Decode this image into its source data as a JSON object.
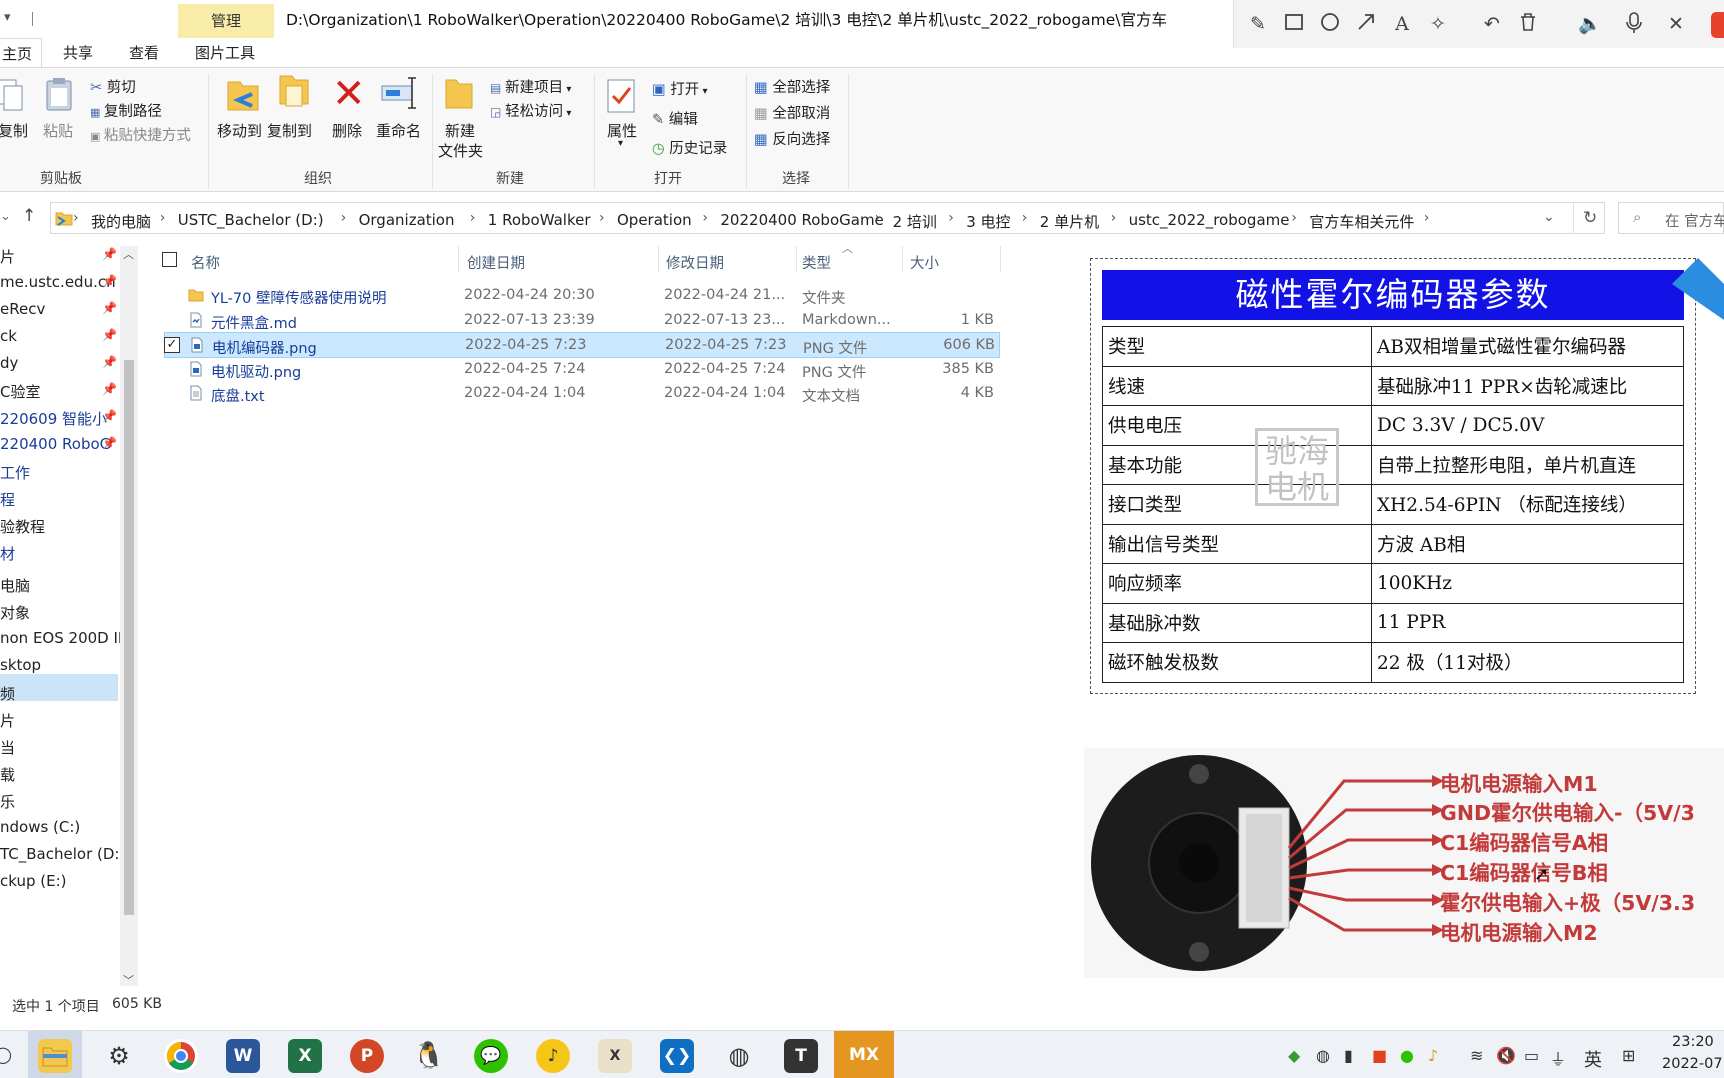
{
  "window": {
    "path_title": "D:\\Organization\\1 RoboWalker\\Operation\\20220400 RoboGame\\2 培训\\3 电控\\2 单片机\\ustc_2022_robogame\\官方车",
    "context_tab": "管理"
  },
  "ribbon_tabs": [
    "主页",
    "共享",
    "查看",
    "图片工具"
  ],
  "ribbon": {
    "copy_label": "复制",
    "paste_label": "粘贴",
    "cut_label": "剪切",
    "copy_path_label": "复制路径",
    "paste_shortcut_label": "粘贴快捷方式",
    "clipboard_group": "剪贴板",
    "move_to_label": "移动到",
    "copy_to_label": "复制到",
    "delete_label": "删除",
    "rename_label": "重命名",
    "organize_group": "组织",
    "new_item_label": "新建项目",
    "easy_access_label": "轻松访问",
    "new_folder_label_1": "新建",
    "new_folder_label_2": "文件夹",
    "new_group": "新建",
    "properties_label": "属性",
    "open_label": "打开",
    "edit_label": "编辑",
    "history_label": "历史记录",
    "open_group": "打开",
    "select_all_label": "全部选择",
    "select_none_label": "全部取消",
    "invert_selection_label": "反向选择",
    "select_group": "选择"
  },
  "breadcrumb": [
    "我的电脑",
    "USTC_Bachelor (D:)",
    "Organization",
    "1 RoboWalker",
    "Operation",
    "20220400 RoboGame",
    "2 培训",
    "3 电控",
    "2 单片机",
    "ustc_2022_robogame",
    "官方车相关元件"
  ],
  "search": {
    "placeholder": "在 官方车"
  },
  "nav_items": [
    {
      "label": "片",
      "pinned": true,
      "blue": false
    },
    {
      "label": "me.ustc.edu.cn",
      "pinned": true,
      "blue": false
    },
    {
      "label": "eRecv",
      "pinned": true,
      "blue": false
    },
    {
      "label": "ck",
      "pinned": true,
      "blue": false
    },
    {
      "label": "dy",
      "pinned": true,
      "blue": false
    },
    {
      "label": "C验室",
      "pinned": true,
      "blue": false
    },
    {
      "label": "220609 智能小",
      "pinned": true,
      "blue": true
    },
    {
      "label": "220400 RoboG",
      "pinned": true,
      "blue": true
    },
    {
      "label": "工作",
      "pinned": false,
      "blue": true
    },
    {
      "label": "程",
      "pinned": false,
      "blue": true
    },
    {
      "label": "验教程",
      "pinned": false,
      "blue": false
    },
    {
      "label": "材",
      "pinned": false,
      "blue": true
    },
    {
      "label": "电脑",
      "pinned": false,
      "blue": false
    },
    {
      "label": "对象",
      "pinned": false,
      "blue": false
    },
    {
      "label": "non EOS 200D II",
      "pinned": false,
      "blue": false
    },
    {
      "label": "sktop",
      "pinned": false,
      "blue": false
    },
    {
      "label": "频",
      "pinned": false,
      "blue": false
    },
    {
      "label": "片",
      "pinned": false,
      "blue": false
    },
    {
      "label": "当",
      "pinned": false,
      "blue": false
    },
    {
      "label": "载",
      "pinned": false,
      "blue": false
    },
    {
      "label": "乐",
      "pinned": false,
      "blue": false
    },
    {
      "label": "ndows (C:)",
      "pinned": false,
      "blue": false
    },
    {
      "label": "TC_Bachelor (D:)",
      "pinned": false,
      "blue": false
    },
    {
      "label": "ckup (E:)",
      "pinned": false,
      "blue": false
    }
  ],
  "columns": {
    "name": "名称",
    "created": "创建日期",
    "modified": "修改日期",
    "type": "类型",
    "size": "大小"
  },
  "files": [
    {
      "name": "YL-70 壁障传感器使用说明",
      "created": "2022-04-24 20:30",
      "modified": "2022-04-24 21...",
      "type": "文件夹",
      "size": "",
      "icon": "folder-icon",
      "selected": false
    },
    {
      "name": "元件黑盒.md",
      "created": "2022-07-13 23:39",
      "modified": "2022-07-13 23...",
      "type": "Markdown...",
      "size": "1 KB",
      "icon": "markdown-file-icon",
      "selected": false
    },
    {
      "name": "电机编码器.png",
      "created": "2022-04-25 7:23",
      "modified": "2022-04-25 7:23",
      "type": "PNG 文件",
      "size": "606 KB",
      "icon": "image-file-icon",
      "selected": true
    },
    {
      "name": "电机驱动.png",
      "created": "2022-04-25 7:24",
      "modified": "2022-04-25 7:24",
      "type": "PNG 文件",
      "size": "385 KB",
      "icon": "image-file-icon",
      "selected": false
    },
    {
      "name": "底盘.txt",
      "created": "2022-04-24 1:04",
      "modified": "2022-04-24 1:04",
      "type": "文本文档",
      "size": "4 KB",
      "icon": "text-file-icon",
      "selected": false
    }
  ],
  "preview": {
    "title": "磁性霍尔编码器参数",
    "rows": [
      {
        "k": "类型",
        "v": "AB双相增量式磁性霍尔编码器"
      },
      {
        "k": "线速",
        "v": "基础脉冲11 PPR×齿轮减速比"
      },
      {
        "k": "供电电压",
        "v": "DC 3.3V / DC5.0V"
      },
      {
        "k": "基本功能",
        "v": "自带上拉整形电阻，单片机直连"
      },
      {
        "k": "接口类型",
        "v": "XH2.54-6PIN （标配连接线）"
      },
      {
        "k": "输出信号类型",
        "v": "方波  AB相"
      },
      {
        "k": "响应频率",
        "v": "100KHz"
      },
      {
        "k": "基础脉冲数",
        "v": "11 PPR"
      },
      {
        "k": "磁环触发极数",
        "v": "22 极（11对极）"
      }
    ],
    "seal_line1": "驰海",
    "seal_line2": "电机",
    "pins": [
      "电机电源输入M1",
      "GND霍尔供电输入-（5V/3",
      "C1编码器信号A相",
      "C1编码器信号B相",
      "霍尔供电输入+极（5V/3.3",
      "电机电源输入M2"
    ]
  },
  "status": {
    "selection": "选中 1 个项目",
    "size": "605 KB"
  },
  "taskbar": {
    "ime": "英",
    "time": "23:20",
    "date": "2022-07"
  }
}
